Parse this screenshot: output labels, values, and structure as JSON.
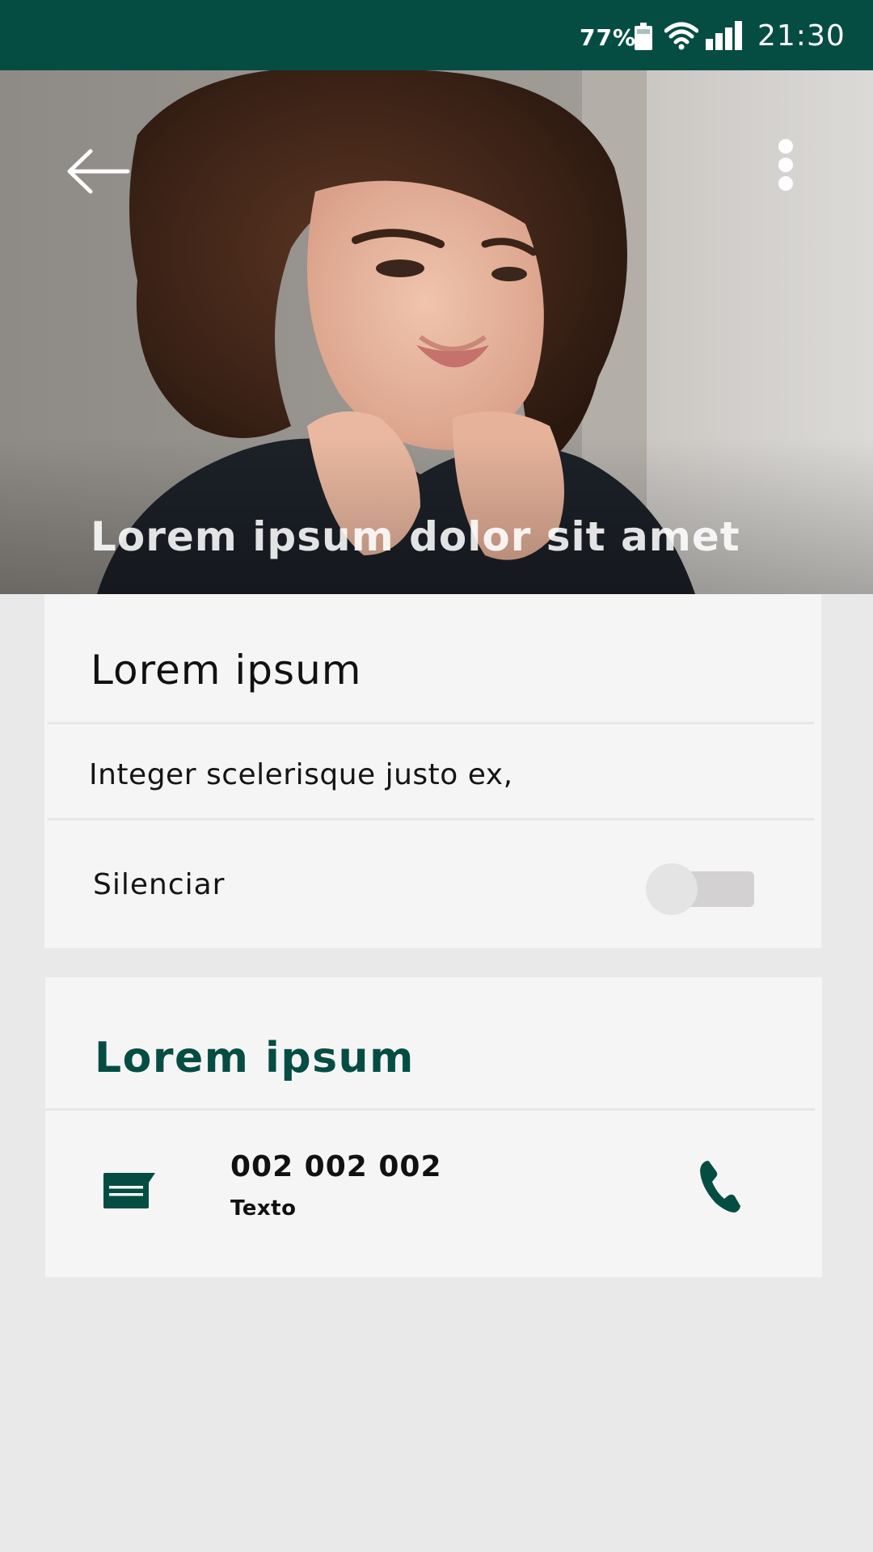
{
  "status_bar": {
    "battery_percent": "77%",
    "time": "21:30"
  },
  "hero": {
    "title": "Lorem ipsum dolor sit amet"
  },
  "card1": {
    "title": "Lorem ipsum",
    "subtitle": "Integer scelerisque justo ex,",
    "mute_label": "Silenciar",
    "mute_enabled": false
  },
  "card2": {
    "title": "Lorem ipsum",
    "contact": {
      "number": "002 002 002",
      "type": "Texto"
    }
  },
  "colors": {
    "primary": "#054d43",
    "background": "#e9e9e9",
    "card": "#f5f5f5"
  },
  "icons": {
    "back": "arrow-left-icon",
    "menu": "more-vertical-icon",
    "message": "message-icon",
    "call": "phone-icon",
    "battery": "battery-icon",
    "wifi": "wifi-icon",
    "signal": "signal-icon"
  }
}
